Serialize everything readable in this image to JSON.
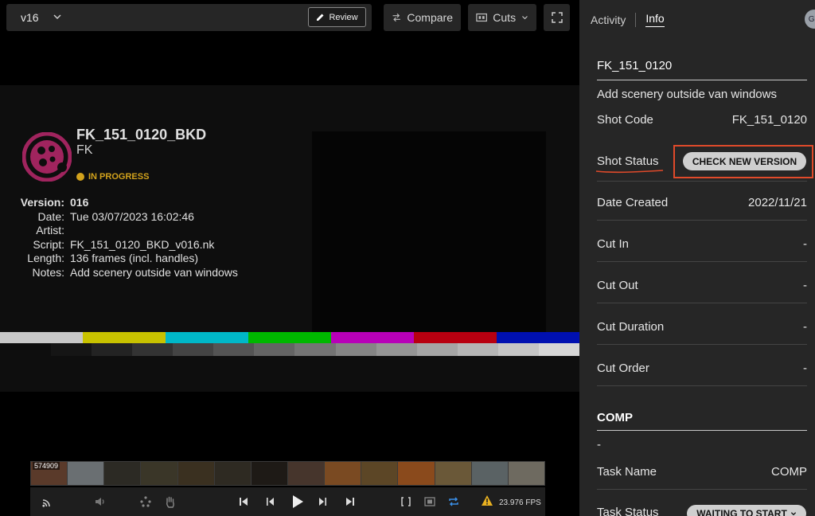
{
  "toolbar": {
    "version": "v16",
    "review_label": "Review",
    "compare_label": "Compare",
    "cuts_label": "Cuts"
  },
  "slate": {
    "title": "FK_151_0120_BKD",
    "subtitle": "FK",
    "status": "IN PROGRESS",
    "status_color": "#d2a21c",
    "logo_color": "#a0245e",
    "fields": [
      {
        "key": "Version:",
        "value": "016"
      },
      {
        "key": "Date:",
        "value": "Tue 03/07/2023  16:02:46"
      },
      {
        "key": "Artist:",
        "value": ""
      },
      {
        "key": "Script:",
        "value": "FK_151_0120_BKD_v016.nk"
      },
      {
        "key": "Length:",
        "value": "136 frames (incl. handles)"
      },
      {
        "key": "Notes:",
        "value": "Add scenery outside van windows"
      }
    ],
    "color_bars": [
      "#c8c8c8",
      "#c8c200",
      "#00b8c8",
      "#00b800",
      "#b800b8",
      "#b80010",
      "#0010b0"
    ],
    "gray_ramp": [
      "#151515",
      "#232323",
      "#333333",
      "#444444",
      "#545454",
      "#646464",
      "#747474",
      "#858585",
      "#959595",
      "#a5a5a5",
      "#b5b5b5",
      "#c5c5c5",
      "#d5d5d5"
    ]
  },
  "filmstrip": {
    "frame": "574909",
    "thumb_colors": [
      "#5a3a2a",
      "#6a6f72",
      "#2c2a24",
      "#3a3628",
      "#3a3020",
      "#2e2a22",
      "#1e1a16",
      "#46352c",
      "#7a4a22",
      "#5c4626",
      "#8a4a1c",
      "#6a5838",
      "#5a6264",
      "#6e6a60"
    ]
  },
  "transport": {
    "fps": "23.976 FPS",
    "warning_color": "#e8b020",
    "loop_color": "#3a8ee6"
  },
  "panel": {
    "tab_activity": "Activity",
    "tab_info": "Info",
    "avatar": "GY",
    "shot_title": "FK_151_0120",
    "description": "Add scenery outside van windows",
    "shot_code_label": "Shot Code",
    "shot_code_value": "FK_151_0120",
    "shot_status_label": "Shot Status",
    "shot_status_value": "CHECK NEW VERSION",
    "rows": [
      {
        "label": "Date Created",
        "value": "2022/11/21"
      },
      {
        "label": "Cut In",
        "value": "-"
      },
      {
        "label": "Cut Out",
        "value": "-"
      },
      {
        "label": "Cut Duration",
        "value": "-"
      },
      {
        "label": "Cut Order",
        "value": "-"
      }
    ],
    "comp_heading": "COMP",
    "comp_dash": "-",
    "task_name_label": "Task Name",
    "task_name_value": "COMP",
    "task_status_label": "Task Status",
    "task_status_value": "WAITING TO START",
    "highlight_color": "#e04a2a"
  }
}
